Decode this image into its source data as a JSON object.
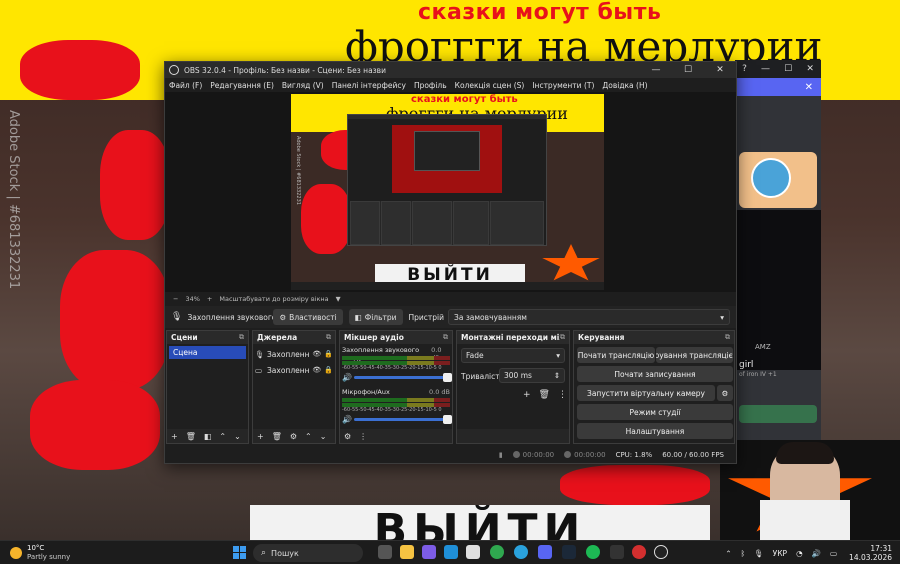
{
  "background": {
    "banner_line1": "сказки могут быть",
    "banner_line2": "фроггги на мерлурии",
    "stock_text": "Adobe Stock | #681332231",
    "exit_text": "ВЫЙТИ"
  },
  "side_window": {
    "help_icon": "?",
    "minimize": "—",
    "maximize": "☐",
    "close": "✕",
    "banner_close": "✕",
    "amz": "AMZ",
    "name": "girl",
    "sub": "of iron IV +1"
  },
  "obs": {
    "title": "OBS 32.0.4 - Профіль: Без назви - Сцени: Без назви",
    "window_controls": {
      "minimize": "—",
      "maximize": "☐",
      "close": "✕"
    },
    "menu": [
      "Файл (F)",
      "Редагування (E)",
      "Вигляд (V)",
      "Панелі інтерфейсу",
      "Профіль",
      "Колекція сцен (S)",
      "Інструменти (T)",
      "Довідка (H)"
    ],
    "preview": {
      "line1": "сказки могут быть",
      "line2": "фроггги на мерлурии",
      "stock": "Adobe Stock | #681332231",
      "exit": "ВЫЙТИ"
    },
    "zoom": {
      "minus": "−",
      "value": "34%",
      "plus": "+",
      "label": "Масштабувати до розміру вікна",
      "arrow": "▼"
    },
    "source_bar": {
      "source_name": "Захоплення звукового вх",
      "properties": "Властивості",
      "filters": "Фільтри",
      "device_label": "Пристрій",
      "device_value": "За замовчуванням"
    },
    "scenes": {
      "title": "Сцени",
      "items": [
        "Сцена"
      ]
    },
    "sources": {
      "title": "Джерела",
      "items": [
        "Захоплення",
        "Захоплення"
      ]
    },
    "mixer": {
      "title": "Мікшер аудіо",
      "channels": [
        {
          "name": "Захоплення звукового входу",
          "db": "0.0 dB"
        },
        {
          "name": "Мікрофон/Aux",
          "db": "0.0 dB"
        }
      ],
      "scale": "-60-55-50-45-40-35-30-25-20-15-10-5 0"
    },
    "transitions": {
      "title": "Монтажні переходи між...",
      "type": "Fade",
      "duration_label": "Тривалість",
      "duration_value": "300 ms"
    },
    "controls": {
      "title": "Керування",
      "start_stream": "Почати трансляцію",
      "stream_manage": "ерування трансляцією",
      "start_record": "Почати записування",
      "virtual_cam": "Запустити віртуальну камеру",
      "studio_mode": "Режим студії",
      "settings": "Налаштування"
    },
    "status": {
      "stream_time": "00:00:00",
      "record_time": "00:00:00",
      "cpu": "CPU: 1.8%",
      "fps": "60.00 / 60.00 FPS"
    }
  },
  "taskbar": {
    "temp": "10°C",
    "condition": "Partly sunny",
    "search": "Пошук",
    "lang": "УКР",
    "time": "17:31",
    "date": "14.03.2026"
  }
}
